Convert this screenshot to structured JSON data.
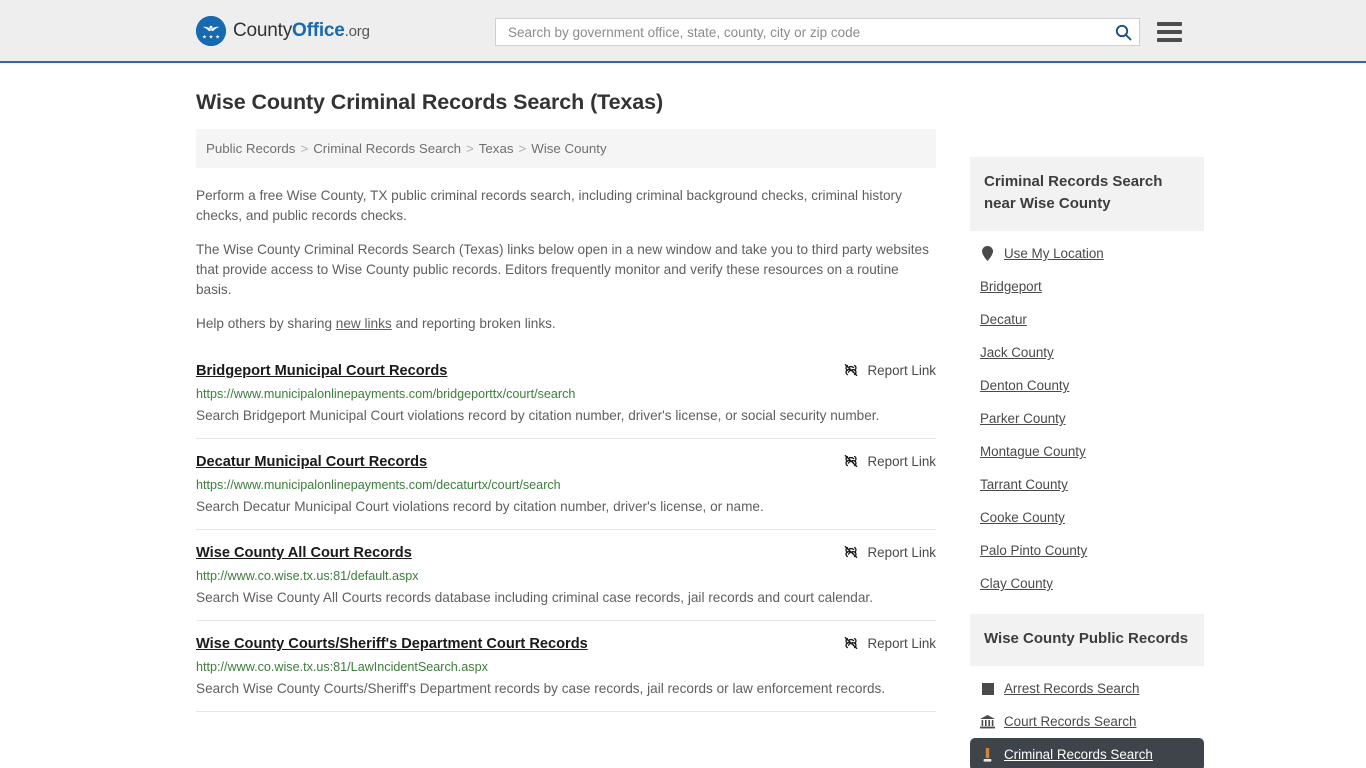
{
  "header": {
    "logo": {
      "icon": "eagle-seal-icon",
      "part1": "County",
      "part2": "Office",
      "part3": ".org"
    },
    "search": {
      "placeholder": "Search by government office, state, county, city or zip code",
      "value": "",
      "search_icon": "search-icon"
    },
    "menu_icon": "hamburger-menu-icon"
  },
  "page": {
    "title": "Wise County Criminal Records Search (Texas)"
  },
  "breadcrumb": {
    "items": [
      {
        "label": "Public Records"
      },
      {
        "label": "Criminal Records Search"
      },
      {
        "label": "Texas"
      },
      {
        "label": "Wise County"
      }
    ],
    "separator": ">"
  },
  "intro": {
    "paragraph1": "Perform a free Wise County, TX public criminal records search, including criminal background checks, criminal history checks, and public records checks.",
    "paragraph2": "The Wise County Criminal Records Search (Texas) links below open in a new window and take you to third party websites that provide access to Wise County public records. Editors frequently monitor and verify these resources on a routine basis.",
    "paragraph3_prefix": "Help others by sharing ",
    "paragraph3_link": "new links",
    "paragraph3_suffix": " and reporting broken links."
  },
  "results": {
    "report_label": "Report Link",
    "report_icon": "broken-link-icon",
    "items": [
      {
        "title": "Bridgeport Municipal Court Records",
        "url": "https://www.municipalonlinepayments.com/bridgeporttx/court/search",
        "description": "Search Bridgeport Municipal Court violations record by citation number, driver's license, or social security number."
      },
      {
        "title": "Decatur Municipal Court Records",
        "url": "https://www.municipalonlinepayments.com/decaturtx/court/search",
        "description": "Search Decatur Municipal Court violations record by citation number, driver's license, or name."
      },
      {
        "title": "Wise County All Court Records",
        "url": "http://www.co.wise.tx.us:81/default.aspx",
        "description": "Search Wise County All Courts records database including criminal case records, jail records and court calendar."
      },
      {
        "title": "Wise County Courts/Sheriff's Department Court Records",
        "url": "http://www.co.wise.tx.us:81/LawIncidentSearch.aspx",
        "description": "Search Wise County Courts/Sheriff's Department records by case records, jail records or law enforcement records."
      }
    ]
  },
  "sidebar": {
    "nearby": {
      "title": "Criminal Records Search near Wise County",
      "use_my_location": {
        "label": "Use My Location",
        "icon": "map-pin-icon"
      },
      "items": [
        {
          "label": "Bridgeport"
        },
        {
          "label": "Decatur"
        },
        {
          "label": "Jack County"
        },
        {
          "label": "Denton County"
        },
        {
          "label": "Parker County"
        },
        {
          "label": "Montague County"
        },
        {
          "label": "Tarrant County"
        },
        {
          "label": "Cooke County"
        },
        {
          "label": "Palo Pinto County"
        },
        {
          "label": "Clay County"
        }
      ]
    },
    "public_records": {
      "title": "Wise County Public Records",
      "items": [
        {
          "label": "Arrest Records Search",
          "icon": "handcuffs-square-icon",
          "active": false
        },
        {
          "label": "Court Records Search",
          "icon": "courthouse-icon",
          "active": false
        },
        {
          "label": "Criminal Records Search",
          "icon": "gavel-icon",
          "active": true
        }
      ]
    }
  },
  "colors": {
    "brand_blue": "#1769b0",
    "header_bg": "#eeeeee",
    "url_green": "#3c7d3c",
    "highlight_dark": "#3f444a"
  }
}
